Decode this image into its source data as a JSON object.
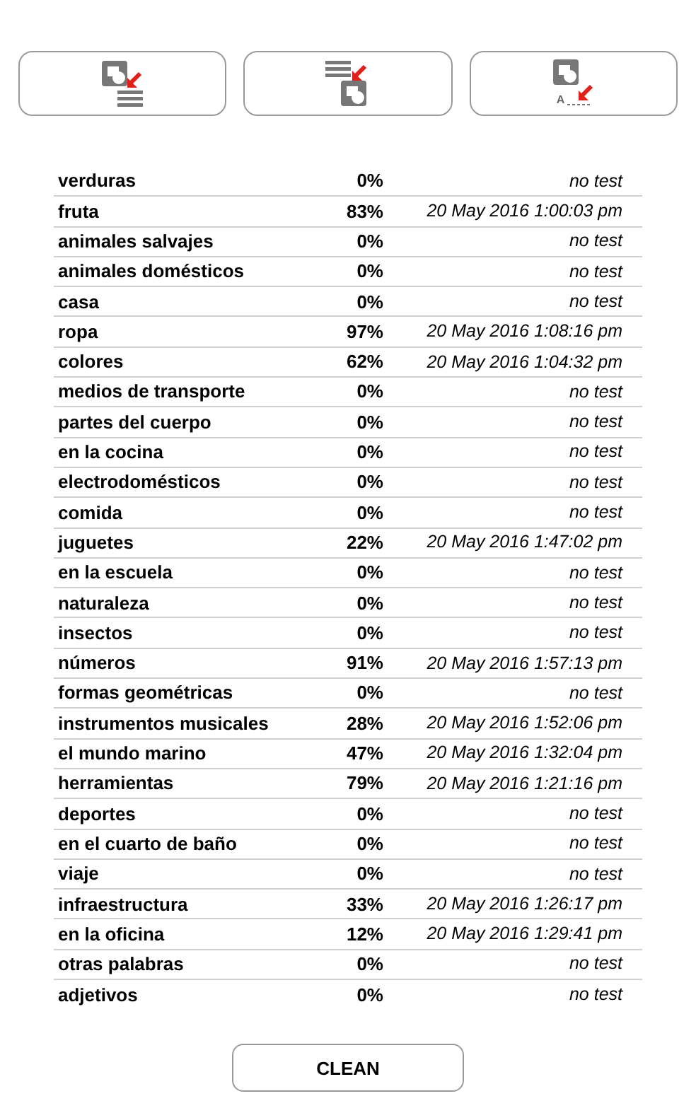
{
  "toolbar": [
    {
      "kind": "picture_to_list"
    },
    {
      "kind": "list_to_picture"
    },
    {
      "kind": "picture_to_text",
      "icon_label": "A"
    }
  ],
  "results": [
    {
      "category": "verduras",
      "score": "0%",
      "tested": "no test"
    },
    {
      "category": "fruta",
      "score": "83%",
      "tested": "20 May 2016 1:00:03 pm"
    },
    {
      "category": "animales salvajes",
      "score": "0%",
      "tested": "no test"
    },
    {
      "category": "animales domésticos",
      "score": "0%",
      "tested": "no test"
    },
    {
      "category": "casa",
      "score": "0%",
      "tested": "no test"
    },
    {
      "category": "ropa",
      "score": "97%",
      "tested": "20 May 2016 1:08:16 pm"
    },
    {
      "category": "colores",
      "score": "62%",
      "tested": "20 May 2016 1:04:32 pm"
    },
    {
      "category": "medios de transporte",
      "score": "0%",
      "tested": "no test"
    },
    {
      "category": "partes del cuerpo",
      "score": "0%",
      "tested": "no test"
    },
    {
      "category": "en la cocina",
      "score": "0%",
      "tested": "no test"
    },
    {
      "category": "electrodomésticos",
      "score": "0%",
      "tested": "no test"
    },
    {
      "category": "comida",
      "score": "0%",
      "tested": "no test"
    },
    {
      "category": "juguetes",
      "score": "22%",
      "tested": "20 May 2016 1:47:02 pm"
    },
    {
      "category": "en la escuela",
      "score": "0%",
      "tested": "no test"
    },
    {
      "category": "naturaleza",
      "score": "0%",
      "tested": "no test"
    },
    {
      "category": "insectos",
      "score": "0%",
      "tested": "no test"
    },
    {
      "category": "números",
      "score": "91%",
      "tested": "20 May 2016 1:57:13 pm"
    },
    {
      "category": "formas geométricas",
      "score": "0%",
      "tested": "no test"
    },
    {
      "category": "instrumentos musicales",
      "score": "28%",
      "tested": "20 May 2016 1:52:06 pm"
    },
    {
      "category": "el mundo marino",
      "score": "47%",
      "tested": "20 May 2016 1:32:04 pm"
    },
    {
      "category": "herramientas",
      "score": "79%",
      "tested": "20 May 2016 1:21:16 pm"
    },
    {
      "category": "deportes",
      "score": "0%",
      "tested": "no test"
    },
    {
      "category": "en el cuarto de baño",
      "score": "0%",
      "tested": "no test"
    },
    {
      "category": "viaje",
      "score": "0%",
      "tested": "no test"
    },
    {
      "category": "infraestructura",
      "score": "33%",
      "tested": "20 May 2016 1:26:17 pm"
    },
    {
      "category": "en la oficina",
      "score": "12%",
      "tested": "20 May 2016 1:29:41 pm"
    },
    {
      "category": "otras palabras",
      "score": "0%",
      "tested": "no test"
    },
    {
      "category": "adjetivos",
      "score": "0%",
      "tested": "no test"
    }
  ],
  "clean_button": "CLEAN"
}
